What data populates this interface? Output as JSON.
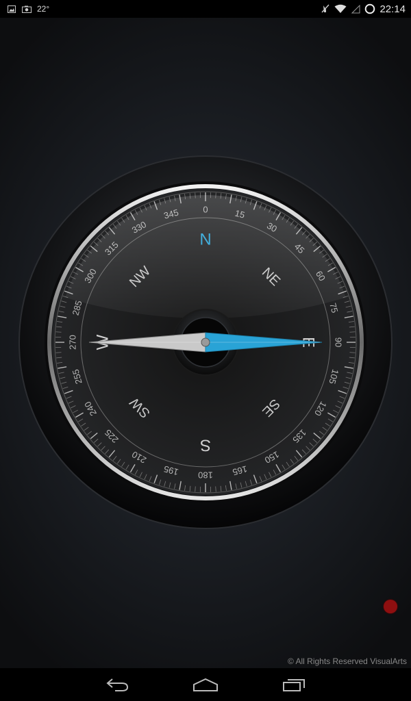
{
  "status_bar": {
    "temperature": "22°",
    "time": "22:14",
    "icons": [
      "image-icon",
      "camera-icon",
      "mute-icon",
      "wifi-icon",
      "signal-icon",
      "sync-icon"
    ]
  },
  "compass": {
    "cardinals": {
      "north": "N",
      "south": "S",
      "west": "W",
      "east": "E"
    },
    "intercardinals": {
      "nw": "NW",
      "ne": "NE",
      "sw": "SW",
      "se": "SE"
    },
    "degree_labels": [
      "0",
      "15",
      "30",
      "45",
      "60",
      "75",
      "90",
      "105",
      "120",
      "135",
      "150",
      "165",
      "180",
      "195",
      "210",
      "225",
      "240",
      "255",
      "270",
      "285",
      "300",
      "315",
      "330",
      "345"
    ],
    "heading_degrees": 90,
    "accent_color": "#29a3d6"
  },
  "footer": {
    "copyright": "© All Rights Reserved VisualArts"
  },
  "record_indicator": {
    "color": "#8e0f10"
  },
  "nav_bar": {
    "back": "back-icon",
    "home": "home-icon",
    "recents": "recents-icon"
  }
}
